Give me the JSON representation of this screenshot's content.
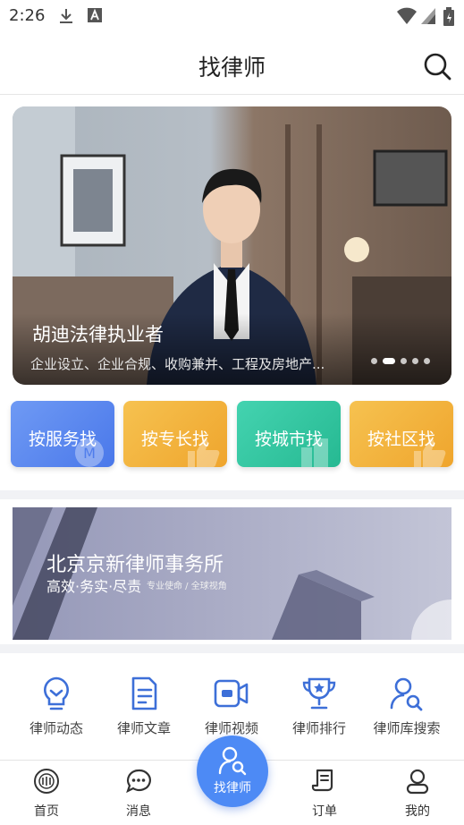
{
  "status_bar": {
    "time": "2:26"
  },
  "header": {
    "title": "找律师"
  },
  "hero": {
    "name": "胡迪法律执业者",
    "description": "企业设立、企业合规、收购兼并、工程及房地产..."
  },
  "categories": [
    {
      "label": "按服务找",
      "color": "#5b86f0"
    },
    {
      "label": "按专长找",
      "color": "#f3b23c"
    },
    {
      "label": "按城市找",
      "color": "#36c9a3"
    },
    {
      "label": "按社区找",
      "color": "#f4b13b"
    }
  ],
  "firm_banner": {
    "name": "北京京新律师事务所",
    "slogan": "高效·务实·尽责",
    "sub": "专业使命 / 全球视角"
  },
  "features": [
    {
      "label": "律师动态",
      "icon": "lightbulb-icon"
    },
    {
      "label": "律师文章",
      "icon": "document-icon"
    },
    {
      "label": "律师视频",
      "icon": "video-icon"
    },
    {
      "label": "律师排行",
      "icon": "trophy-icon"
    },
    {
      "label": "律师库搜索",
      "icon": "person-search-icon"
    }
  ],
  "bottom_nav": {
    "home": "首页",
    "messages": "消息",
    "find_lawyer": "找律师",
    "orders": "订单",
    "mine": "我的"
  },
  "colors": {
    "accent": "#4d8af5",
    "icon_blue": "#3d6fd8"
  }
}
